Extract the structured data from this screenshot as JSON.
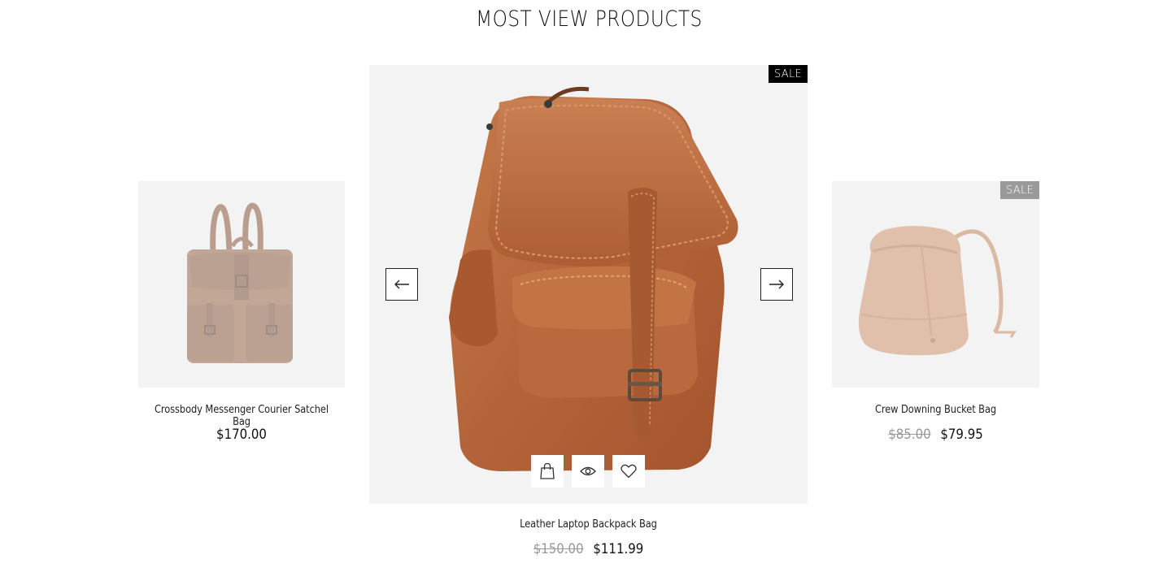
{
  "section": {
    "title": "MOST VIEW PRODUCTS"
  },
  "carousel": {
    "prev_icon": "arrow-left-icon",
    "next_icon": "arrow-right-icon"
  },
  "products": [
    {
      "name": "Crossbody Messenger Courier Satchel Bag",
      "price": "$170.00",
      "badge": "",
      "image_icon": "leather-backpack-image"
    },
    {
      "name": "Leather Laptop Backpack Bag",
      "old_price": "$150.00",
      "price": "$111.99",
      "badge": "SALE",
      "image_icon": "leather-laptop-backpack-image",
      "actions": [
        "shopping-bag-icon",
        "eye-icon",
        "heart-icon"
      ]
    },
    {
      "name": "Crew Downing Bucket Bag",
      "old_price": "$85.00",
      "price": "$79.95",
      "badge": "SALE",
      "image_icon": "bucket-bag-image"
    }
  ],
  "colors": {
    "leather": "#b4643a",
    "badge_dark": "#000000",
    "badge_grey": "#9a9a9a",
    "image_bg": "#f3f3f3"
  }
}
